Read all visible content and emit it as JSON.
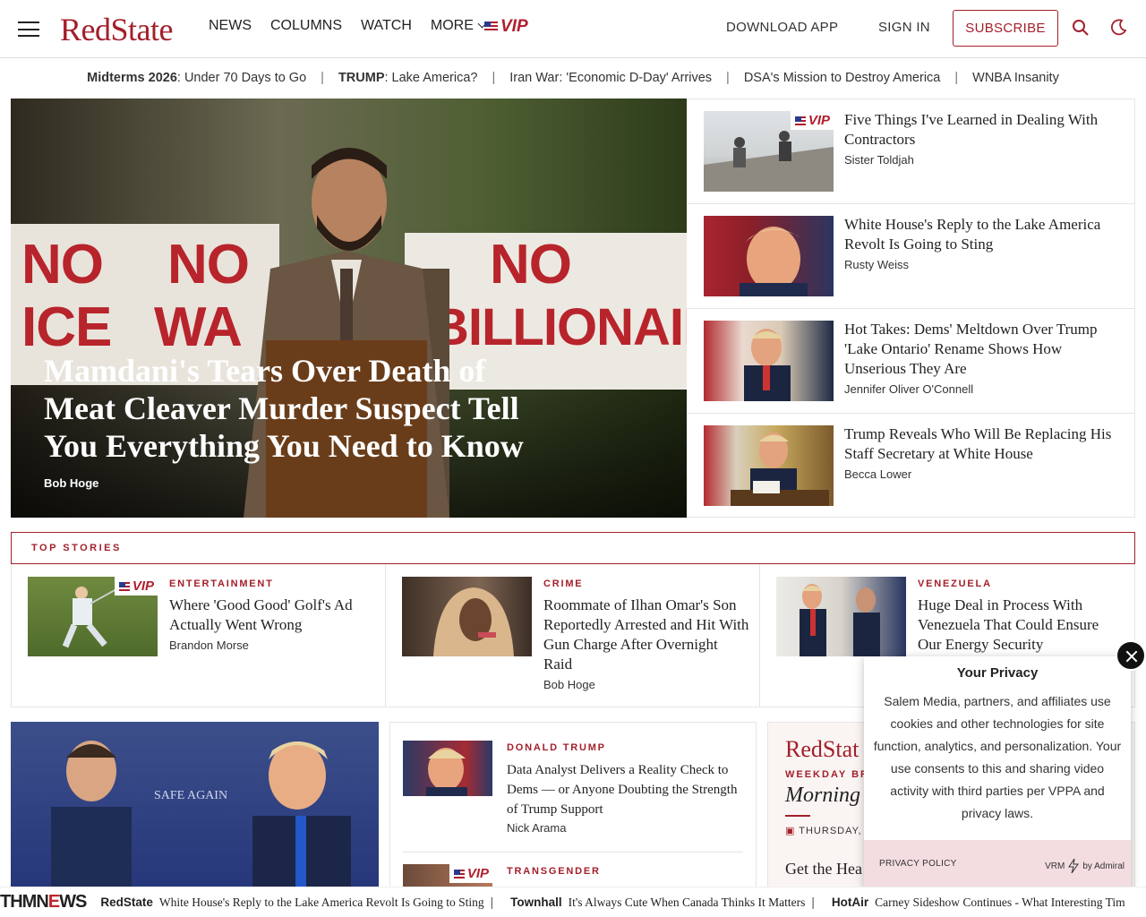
{
  "header": {
    "logo": "RedState",
    "nav": [
      "NEWS",
      "COLUMNS",
      "WATCH",
      "MORE"
    ],
    "vip_label": "VIP",
    "download_app": "DOWNLOAD APP",
    "sign_in": "SIGN IN",
    "subscribe": "SUBSCRIBE"
  },
  "trending": [
    {
      "bold": "Midterms 2026",
      "rest": ": Under 70 Days to Go"
    },
    {
      "bold": "TRUMP",
      "rest": ": Lake America?"
    },
    {
      "bold": "",
      "rest": "Iran War: 'Economic D-Day' Arrives"
    },
    {
      "bold": "",
      "rest": "DSA's Mission to Destroy America"
    },
    {
      "bold": "",
      "rest": "WNBA Insanity"
    }
  ],
  "hero": {
    "banner_left_1": "NO",
    "banner_left_2": "ICE",
    "banner_mid_1": "NO",
    "banner_mid_2": "WA",
    "banner_right_1": "NO",
    "banner_right_2": "BILLIONAIRES",
    "headline": "Mamdani's Tears Over Death of Meat Cleaver Murder Suspect Tell You Everything You Need to Know",
    "author": "Bob Hoge"
  },
  "side_articles": [
    {
      "title": "Five Things I've Learned in Dealing With Contractors",
      "author": "Sister Toldjah",
      "vip": true
    },
    {
      "title": "White House's Reply to the Lake America Revolt Is Going to Sting",
      "author": "Rusty Weiss",
      "vip": false
    },
    {
      "title": "Hot Takes: Dems' Meltdown Over Trump 'Lake Ontario' Rename Shows How Unserious They Are",
      "author": "Jennifer Oliver O'Connell",
      "vip": false
    },
    {
      "title": "Trump Reveals Who Will Be Replacing His Staff Secretary at White House",
      "author": "Becca Lower",
      "vip": false
    }
  ],
  "top_stories": {
    "label": "TOP STORIES",
    "items": [
      {
        "category": "ENTERTAINMENT",
        "title": "Where 'Good Good' Golf's Ad Actually Went Wrong",
        "author": "Brandon Morse",
        "vip": true
      },
      {
        "category": "CRIME",
        "title": "Roommate of Ilhan Omar's Son Reportedly Arrested and Hit With Gun Charge After Overnight Raid",
        "author": "Bob Hoge",
        "vip": false
      },
      {
        "category": "VENEZUELA",
        "title": "Huge Deal in Process With Venezuela That Could Ensure Our Energy Security",
        "author": "",
        "vip": false
      }
    ]
  },
  "big_image_text": "MAKING AMERICA SAFE AGAIN",
  "mid_column": [
    {
      "category": "DONALD TRUMP",
      "title": "Data Analyst Delivers a Reality Check to Dems — or Anyone Doubting the Strength of Trump Support",
      "author": "Nick Arama",
      "vip": false
    },
    {
      "category": "TRANSGENDER",
      "title": "",
      "author": "",
      "vip": true
    }
  ],
  "briefing": {
    "logo": "RedStat",
    "sub": "WEEKDAY BR",
    "title": "Morning",
    "date": "THURSDAY, A",
    "get": "Get the Hea"
  },
  "privacy": {
    "title": "Your Privacy",
    "body": "Salem Media, partners, and affiliates use cookies and other technologies for site function, analytics, and personalization. Your use consents to this and sharing video activity with third parties per VPPA and privacy laws.",
    "link": "PRIVACY POLICY",
    "brand_prefix": "VRM",
    "brand_suffix": "by Admiral"
  },
  "ticker": {
    "logo_left": "THMN",
    "logo_mid": "E",
    "logo_right": "WS",
    "items": [
      {
        "source": "RedState",
        "headline": "White House's Reply to the Lake America Revolt Is Going to Sting"
      },
      {
        "source": "Townhall",
        "headline": "It's Always Cute When Canada Thinks It Matters"
      },
      {
        "source": "HotAir",
        "headline": "Carney Sideshow Continues - What Interesting Tim"
      }
    ]
  },
  "colors": {
    "brand_red": "#a31f2a",
    "vip_blue": "#2b3a8c"
  }
}
